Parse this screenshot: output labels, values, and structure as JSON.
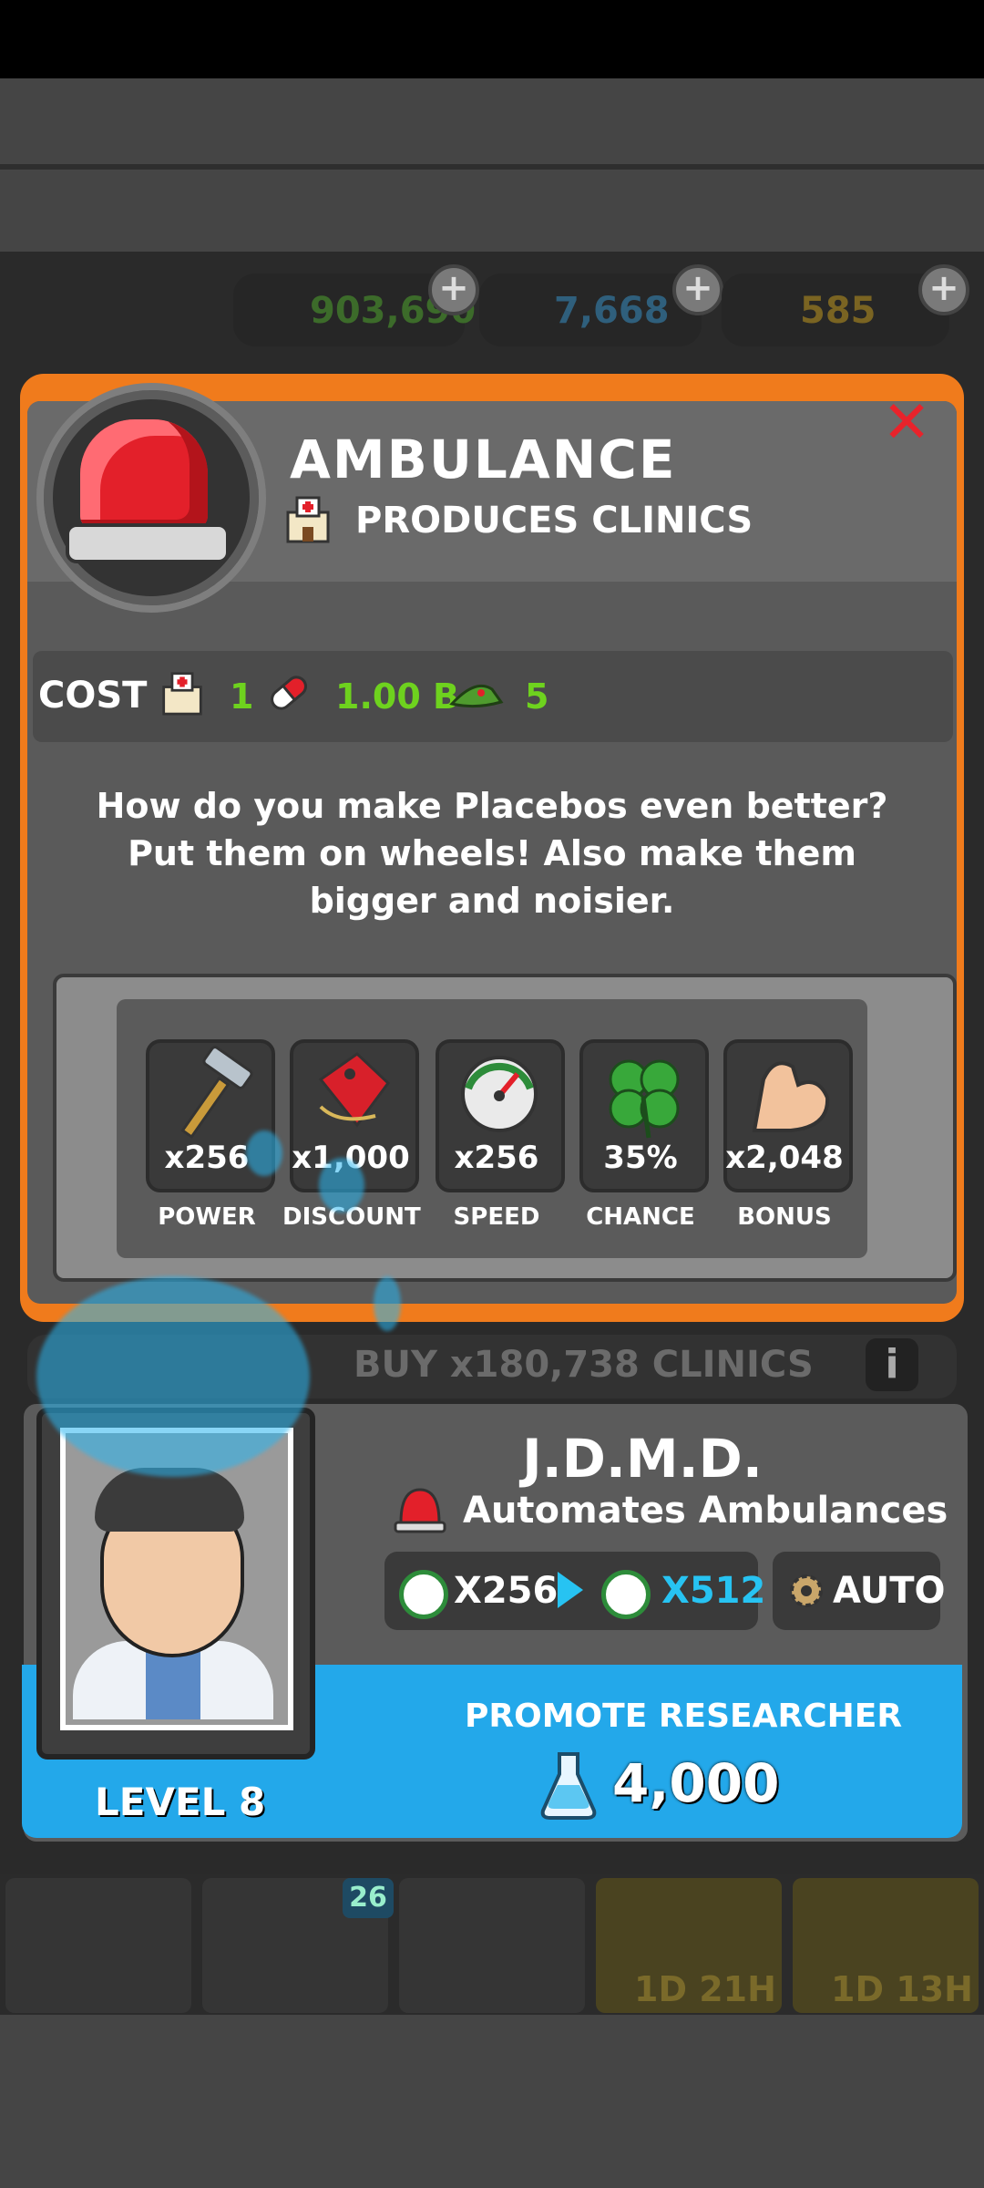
{
  "resources": {
    "cash": "903,690",
    "flasks": "7,668",
    "gold": "585"
  },
  "dialog": {
    "title": "AMBULANCE",
    "subtitle": "PRODUCES CLINICS",
    "cost_label": "COST",
    "costs": [
      {
        "icon": "clinic-icon",
        "value": "1"
      },
      {
        "icon": "pill-icon",
        "value": "1.00 B"
      },
      {
        "icon": "cap-icon",
        "value": "5"
      }
    ],
    "description": "How do you make Placebos even better? Put them on wheels! Also make them bigger and noisier.",
    "stats": [
      {
        "icon": "hammer-icon",
        "value": "x256",
        "label": "POWER"
      },
      {
        "icon": "price-tag-icon",
        "value": "x1,000",
        "label": "DISCOUNT"
      },
      {
        "icon": "speedometer-icon",
        "value": "x256",
        "label": "SPEED"
      },
      {
        "icon": "clover-icon",
        "value": "35%",
        "label": "CHANCE"
      },
      {
        "icon": "muscle-arm-icon",
        "value": "x2,048",
        "label": "BONUS"
      }
    ],
    "buy_label": "BUY x180,738 CLINICS",
    "info": "i"
  },
  "researcher": {
    "name": "J.D.M.D.",
    "ability": "Automates Ambulances",
    "current_mult": "X256",
    "next_mult": "X512",
    "auto_label": "AUTO",
    "promote_label": "PROMOTE RESEARCHER",
    "promote_cost": "4,000",
    "level": "LEVEL 8"
  },
  "nav": {
    "badge": "26",
    "timers": [
      "1D 21H",
      "1D 13H"
    ]
  },
  "colors": {
    "accent_orange": "#f07b1c",
    "promote_blue": "#23a8ea",
    "cost_green": "#6ed21e",
    "close_red": "#e8232b",
    "next_mult_cyan": "#27c3f2"
  }
}
